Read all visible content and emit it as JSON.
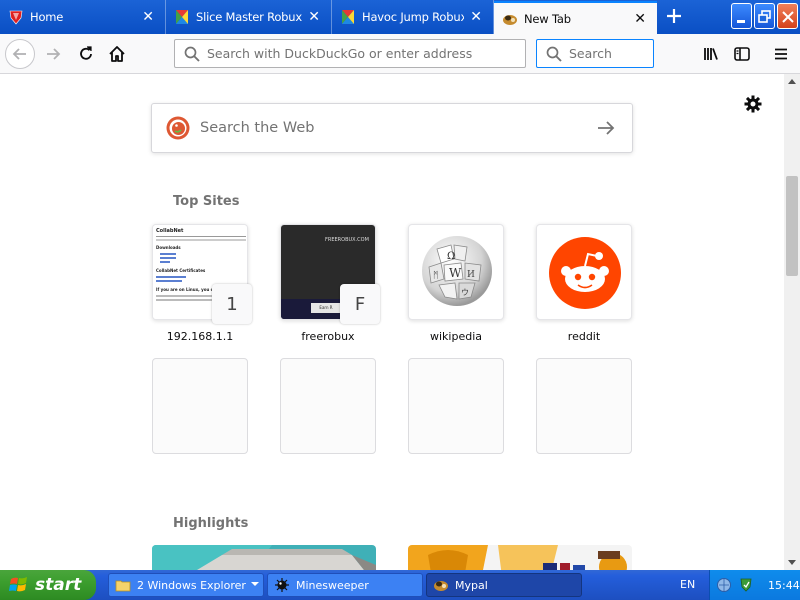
{
  "tabs": [
    {
      "title": "Home",
      "favicon": "red-shield-icon"
    },
    {
      "title": "Slice Master Robux Ro",
      "favicon": "roblox-studio-icon"
    },
    {
      "title": "Havoc Jump Robux Ro",
      "favicon": "roblox-studio-icon"
    },
    {
      "title": "New Tab",
      "favicon": "mypal-icon",
      "active": true
    }
  ],
  "toolbar": {
    "url_placeholder": "Search with DuckDuckGo or enter address",
    "search_placeholder": "Search"
  },
  "newtab": {
    "web_search_placeholder": "Search the Web",
    "topsites_title": "Top Sites",
    "highlights_title": "Highlights",
    "top_sites": [
      {
        "label": "192.168.1.1",
        "badge": "1",
        "thumb_title": "CollabNet",
        "thumb_subtitle": "Downloads",
        "thumb_line": "CollabNet Certificates",
        "thumb_footer": "If you are on Linux, you can"
      },
      {
        "label": "freerobux",
        "badge": "F",
        "thumb_title": "FREEROBUX.COM",
        "thumb_button": "Earn R"
      },
      {
        "label": "wikipedia",
        "icon": "wikipedia-globe-icon"
      },
      {
        "label": "reddit",
        "icon": "reddit-alien-icon"
      }
    ]
  },
  "taskbar": {
    "start_label": "start",
    "tasks": [
      {
        "label": "2 Windows Explorer",
        "icon": "folder-icon"
      },
      {
        "label": "Minesweeper",
        "icon": "minesweeper-icon"
      },
      {
        "label": "Mypal",
        "icon": "mypal-icon",
        "active": true
      }
    ],
    "language": "EN",
    "clock": "15:44"
  },
  "colors": {
    "titlebar_blue": "#0a4fc4",
    "taskbar_blue": "#245edb",
    "start_green": "#3c9e2e",
    "reddit_orange": "#ff4500",
    "focus_blue": "#0a84ff"
  }
}
